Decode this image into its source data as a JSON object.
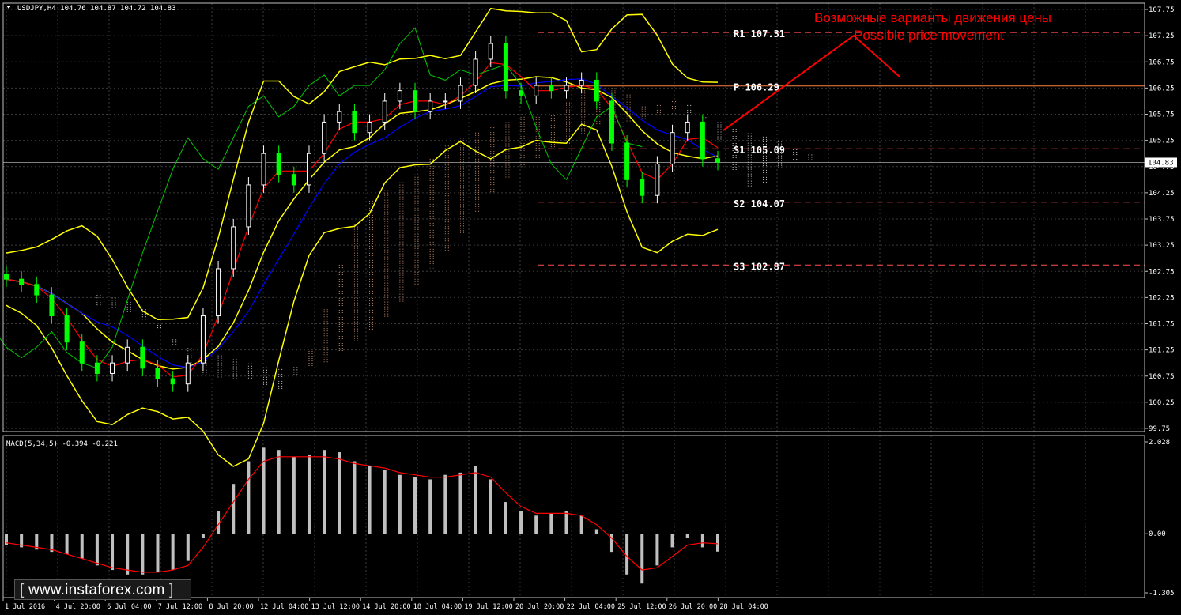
{
  "chart_data": [
    {
      "type": "candlestick",
      "symbol_header": "USDJPY,H4  104.76 104.87 104.72 104.83",
      "current_price": "104.83",
      "annotation_ru": "Возможные варианты движения цены",
      "annotation_en": "Possible price movement",
      "yaxis_ticks": [
        "107.75",
        "107.25",
        "106.75",
        "106.25",
        "105.75",
        "105.25",
        "104.75",
        "104.25",
        "103.75",
        "103.25",
        "102.75",
        "102.25",
        "101.75",
        "101.25",
        "100.75",
        "100.25",
        "99.75"
      ],
      "ylim": [
        99.75,
        107.75
      ],
      "pivot_levels": [
        {
          "label": "R1 107.31",
          "value": 107.31
        },
        {
          "label": "P 106.29",
          "value": 106.29
        },
        {
          "label": "S1 105.09",
          "value": 105.09
        },
        {
          "label": "S2 104.07",
          "value": 104.07
        },
        {
          "label": "S3 102.87",
          "value": 102.87
        }
      ],
      "x_tick_labels": [
        "1 Jul 2016",
        "4 Jul 20:00",
        "6 Jul 04:00",
        "7 Jul 12:00",
        "8 Jul 20:00",
        "12 Jul 04:00",
        "13 Jul 12:00",
        "14 Jul 20:00",
        "18 Jul 04:00",
        "19 Jul 12:00",
        "20 Jul 20:00",
        "22 Jul 04:00",
        "25 Jul 12:00",
        "26 Jul 20:00",
        "28 Jul 04:00"
      ],
      "close_path": [
        102.6,
        102.5,
        102.3,
        101.9,
        101.4,
        101.0,
        100.8,
        101.0,
        101.3,
        100.9,
        100.7,
        100.6,
        101.0,
        101.9,
        102.8,
        103.6,
        104.4,
        105.0,
        104.6,
        104.4,
        105.0,
        105.6,
        105.8,
        105.4,
        105.6,
        106.0,
        106.2,
        105.8,
        106.0,
        106.0,
        106.3,
        106.8,
        107.1,
        106.2,
        106.1,
        106.3,
        106.2,
        106.3,
        106.4,
        106.0,
        105.2,
        104.5,
        104.2,
        104.8,
        105.4,
        105.6,
        104.9,
        104.83
      ],
      "colors": {
        "bull": "#ffffff",
        "bear": "#00ff00",
        "bollinger": "#ffff00",
        "kijun": "#0000ff",
        "tenkan": "#ff0000",
        "chikou": "#00c800",
        "annotation": "#ff0000",
        "pivot": "#ff5050"
      }
    },
    {
      "type": "bar",
      "header": "MACD(5,34,5) -0.394 -0.221",
      "yaxis_ticks": [
        "2.028",
        "0.00",
        "-1.305"
      ],
      "ylim": [
        -1.305,
        2.028
      ],
      "values": [
        -0.25,
        -0.3,
        -0.35,
        -0.4,
        -0.45,
        -0.55,
        -0.7,
        -0.8,
        -0.9,
        -0.9,
        -0.85,
        -0.8,
        -0.6,
        -0.1,
        0.5,
        1.1,
        1.6,
        1.9,
        1.85,
        1.7,
        1.75,
        1.85,
        1.8,
        1.6,
        1.5,
        1.4,
        1.3,
        1.25,
        1.2,
        1.3,
        1.35,
        1.5,
        1.2,
        0.7,
        0.5,
        0.4,
        0.45,
        0.5,
        0.4,
        0.1,
        -0.4,
        -0.9,
        -1.1,
        -0.7,
        -0.3,
        -0.1,
        -0.3,
        -0.394
      ],
      "signal_line": [
        -0.2,
        -0.25,
        -0.3,
        -0.35,
        -0.45,
        -0.55,
        -0.65,
        -0.75,
        -0.8,
        -0.85,
        -0.85,
        -0.8,
        -0.7,
        -0.3,
        0.2,
        0.7,
        1.2,
        1.6,
        1.7,
        1.7,
        1.7,
        1.7,
        1.65,
        1.55,
        1.5,
        1.45,
        1.35,
        1.3,
        1.25,
        1.25,
        1.3,
        1.35,
        1.25,
        0.9,
        0.6,
        0.45,
        0.45,
        0.45,
        0.4,
        0.2,
        -0.1,
        -0.5,
        -0.8,
        -0.75,
        -0.5,
        -0.25,
        -0.2,
        -0.221
      ]
    }
  ],
  "watermark": {
    "prefix": "[",
    "text": " www.instaforex.com ",
    "suffix": "]"
  }
}
